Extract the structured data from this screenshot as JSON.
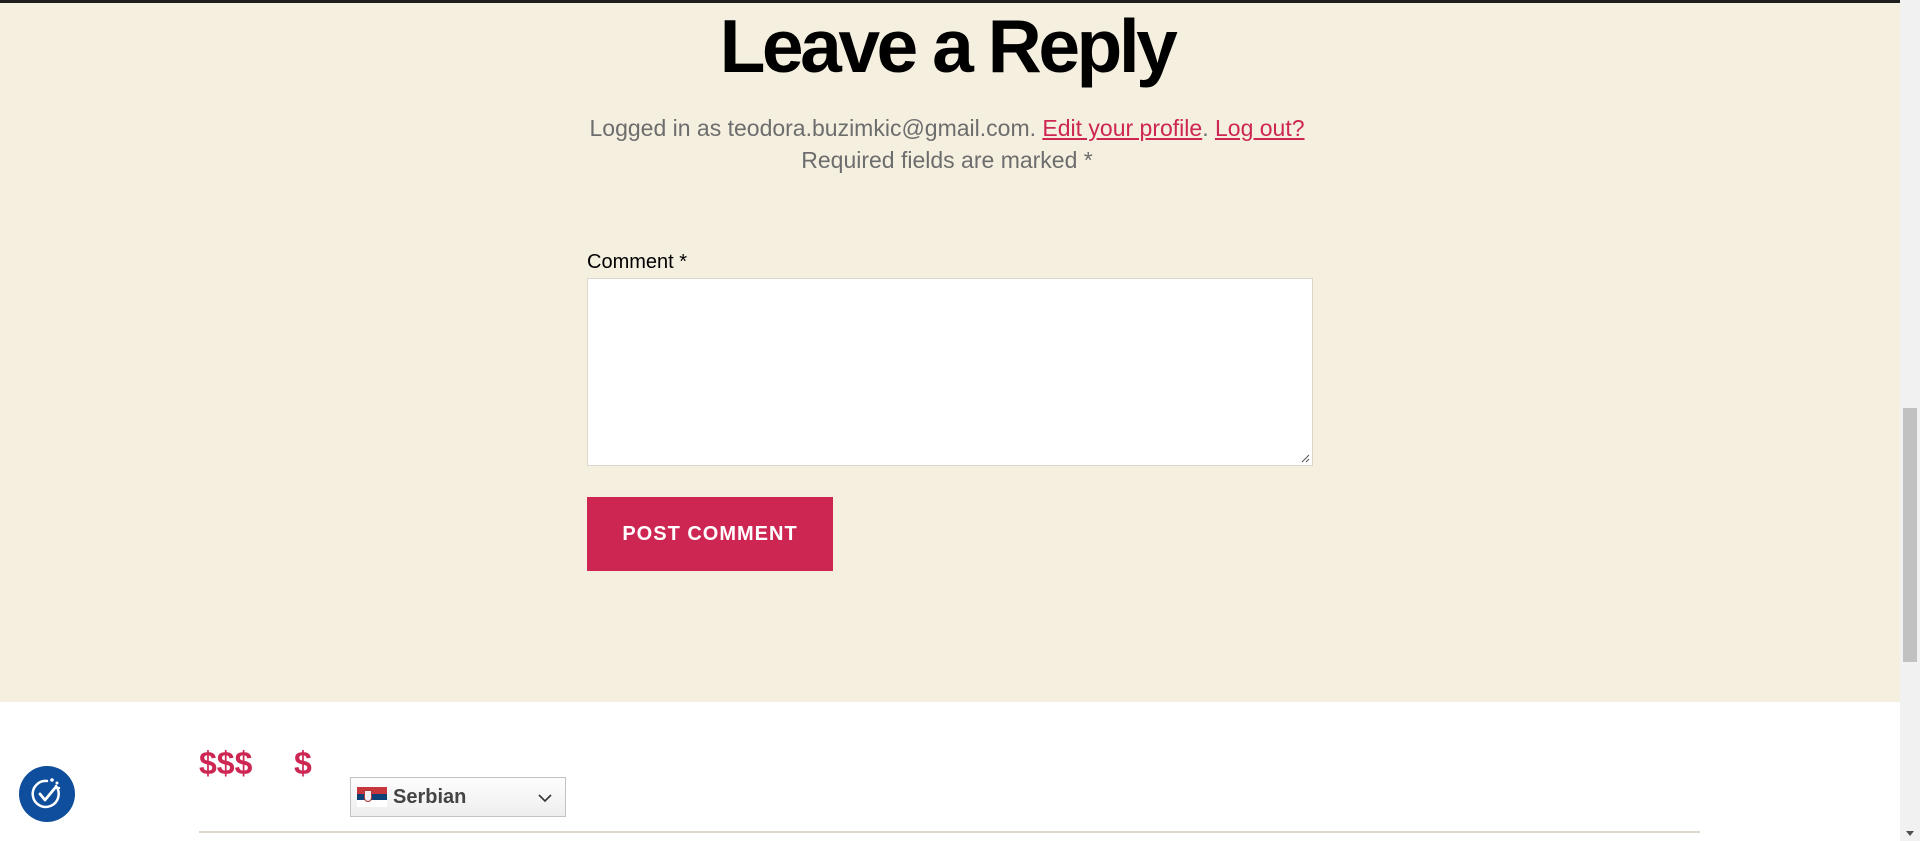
{
  "reply": {
    "title": "Leave a Reply",
    "logged_in_prefix": "Logged in as teodora.buzimkic@gmail.com.",
    "edit_profile_link": "Edit your profile",
    "separator": ".",
    "logout_link": "Log out?",
    "required_text": "Required fields are marked *"
  },
  "form": {
    "comment_label": "Comment *",
    "comment_value": "",
    "submit_label": "POST COMMENT"
  },
  "footer": {
    "price_expensive": "$$$",
    "price_cheap": "$",
    "language": {
      "selected": "Serbian",
      "flag_icon": "serbia-flag-icon"
    }
  },
  "colors": {
    "accent": "#cd2653",
    "section_background": "#f5efe0",
    "accessibility_blue": "#0e4e9c"
  },
  "icons": {
    "accessibility": "accessibility-checkmark-icon",
    "dropdown": "chevron-down-icon",
    "resize": "resize-grip-icon"
  }
}
